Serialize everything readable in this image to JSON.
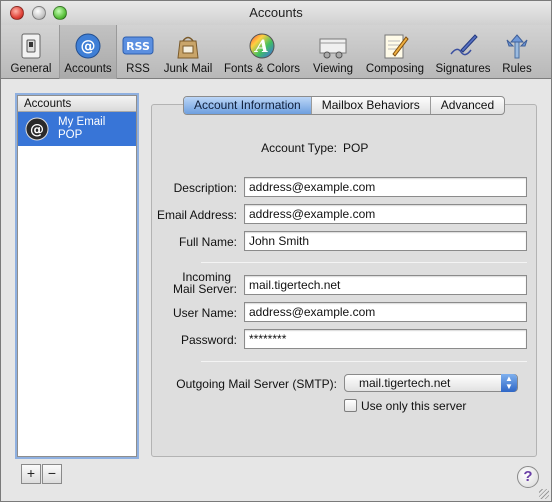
{
  "window": {
    "title": "Accounts"
  },
  "toolbar": {
    "items": [
      {
        "label": "General",
        "icon": "light-switch-icon"
      },
      {
        "label": "Accounts",
        "icon": "at-sign-icon",
        "selected": true
      },
      {
        "label": "RSS",
        "icon": "rss-icon"
      },
      {
        "label": "Junk Mail",
        "icon": "junk-mail-bag-icon"
      },
      {
        "label": "Fonts & Colors",
        "icon": "fonts-colors-icon"
      },
      {
        "label": "Viewing",
        "icon": "viewing-icon"
      },
      {
        "label": "Composing",
        "icon": "composing-pencil-icon"
      },
      {
        "label": "Signatures",
        "icon": "signature-pen-icon"
      },
      {
        "label": "Rules",
        "icon": "rules-icon"
      }
    ]
  },
  "sidebar": {
    "header": "Accounts",
    "accounts": [
      {
        "name": "My Email",
        "type": "POP",
        "selected": true
      }
    ],
    "add_label": "+",
    "remove_label": "−"
  },
  "tabs": [
    {
      "label": "Account Information",
      "active": true
    },
    {
      "label": "Mailbox Behaviors",
      "active": false
    },
    {
      "label": "Advanced",
      "active": false
    }
  ],
  "account_info": {
    "account_type_label": "Account Type:",
    "account_type_value": "POP",
    "description_label": "Description:",
    "description_value": "address@example.com",
    "email_label": "Email Address:",
    "email_value": "address@example.com",
    "fullname_label": "Full Name:",
    "fullname_value": "John Smith",
    "incoming_label_line1": "Incoming",
    "incoming_label_line2": "Mail Server:",
    "incoming_value": "mail.tigertech.net",
    "username_label": "User Name:",
    "username_value": "address@example.com",
    "password_label": "Password:",
    "password_value": "********",
    "smtp_label": "Outgoing Mail Server (SMTP):",
    "smtp_value": "mail.tigertech.net",
    "use_only_label": "Use only this server",
    "use_only_checked": false
  },
  "help_label": "?",
  "colors": {
    "selection": "#3875d7",
    "active_tab": "#6e9fdf"
  }
}
